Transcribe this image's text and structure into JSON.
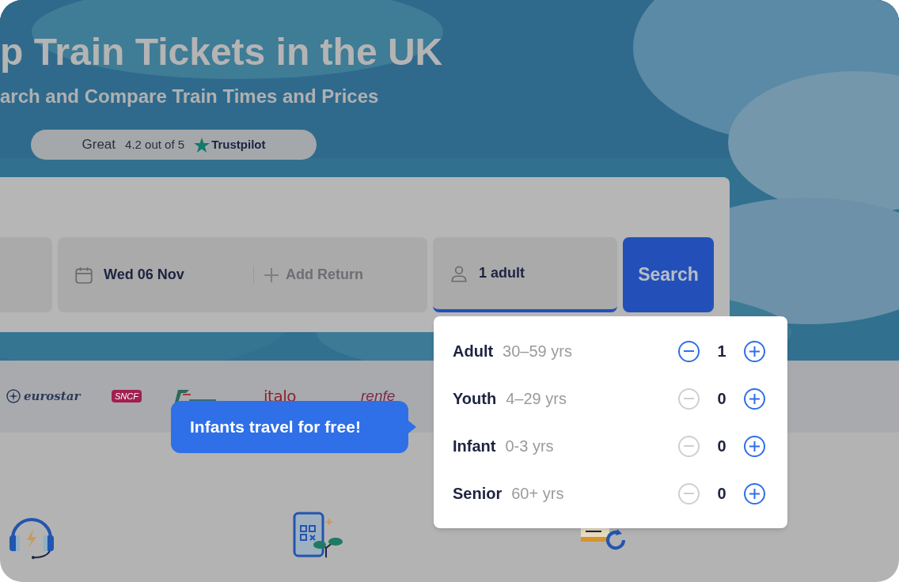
{
  "hero": {
    "title": "p Train Tickets in the UK",
    "subtitle": "arch and Compare Train Times and Prices",
    "rating": {
      "label": "Great",
      "score": "4.2 out of 5",
      "brand": "Trustpilot"
    }
  },
  "search": {
    "date": "Wed 06 Nov",
    "return_placeholder": "Add Return",
    "passengers": "1 adult",
    "passengers_focused": true,
    "button": "Search"
  },
  "operators": [
    {
      "kind": "eurostar",
      "name": "eurostar"
    },
    {
      "kind": "sncf",
      "name": "SNCF"
    },
    {
      "kind": "trenitalia"
    },
    {
      "kind": "italo",
      "name": "italo"
    },
    {
      "kind": "renfe",
      "name": "renfe"
    }
  ],
  "tooltip": "Infants travel for free!",
  "passenger_types": [
    {
      "label": "Adult",
      "ages": "30–59 yrs",
      "count": "1",
      "minus_disabled": false
    },
    {
      "label": "Youth",
      "ages": "4–29 yrs",
      "count": "0",
      "minus_disabled": true
    },
    {
      "label": "Infant",
      "ages": "0-3 yrs",
      "count": "0",
      "minus_disabled": true
    },
    {
      "label": "Senior",
      "ages": "60+ yrs",
      "count": "0",
      "minus_disabled": true
    }
  ],
  "features": [
    {
      "kind": "support"
    },
    {
      "kind": "mobile"
    },
    {
      "kind": "refund"
    }
  ]
}
